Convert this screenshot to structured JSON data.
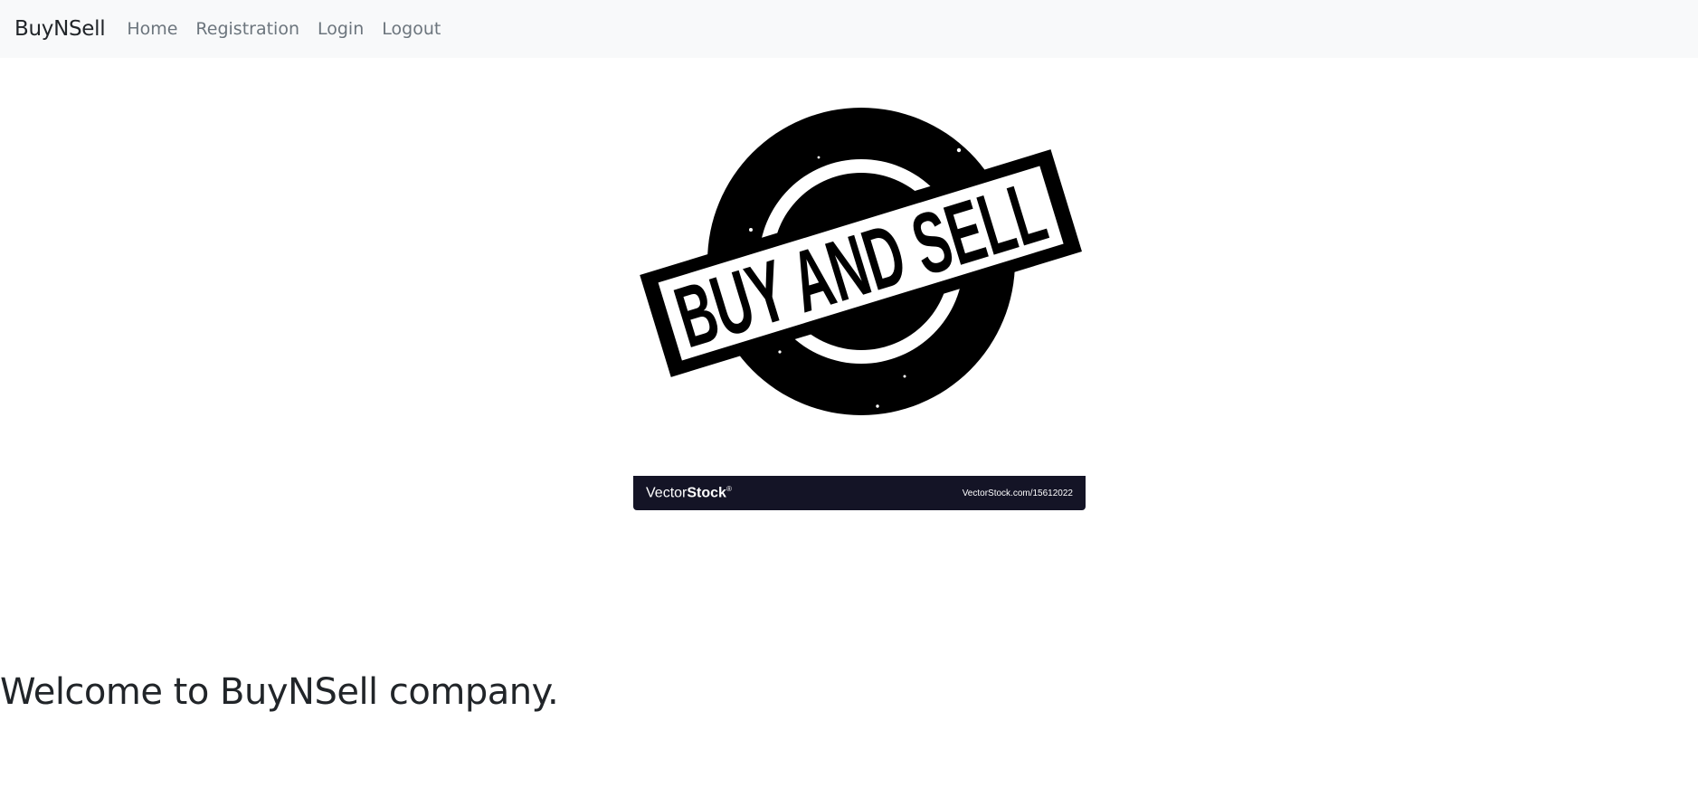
{
  "navbar": {
    "brand": "BuyNSell",
    "links": [
      {
        "label": "Home"
      },
      {
        "label": "Registration"
      },
      {
        "label": "Login"
      },
      {
        "label": "Logout"
      }
    ]
  },
  "hero": {
    "stamp_text": "BUY AND SELL",
    "watermark": {
      "logo_light": "Vector",
      "logo_bold": "Stock",
      "logo_mark": "®",
      "id_text": "VectorStock.com/15612022"
    }
  },
  "main": {
    "heading": "Welcome to BuyNSell company."
  },
  "colors": {
    "navbar_bg": "#f8f9fa",
    "link_color": "#6c757d",
    "stamp": "#000000",
    "watermark_bg": "#141426"
  }
}
